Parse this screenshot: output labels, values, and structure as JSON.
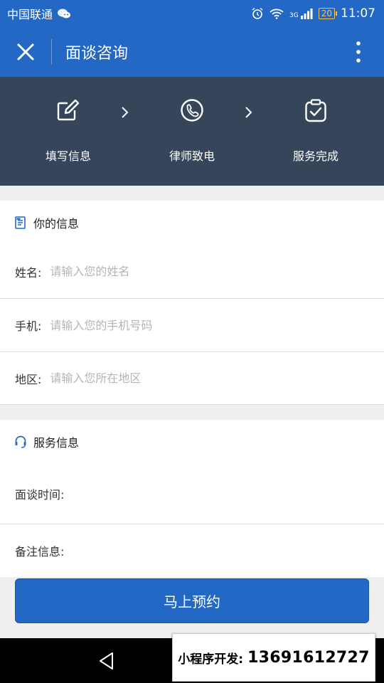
{
  "status_bar": {
    "carrier": "中国联通",
    "network": "3G",
    "battery": "20",
    "time": "11:07",
    "icons": [
      "wechat-icon",
      "alarm-icon",
      "wifi-icon",
      "signal-icon",
      "battery-icon"
    ]
  },
  "title_bar": {
    "title": "面谈咨询",
    "close_icon": "close-icon",
    "more_icon": "more-vertical-icon"
  },
  "steps": [
    {
      "label": "填写信息",
      "icon": "edit-icon"
    },
    {
      "label": "律师致电",
      "icon": "phone-icon"
    },
    {
      "label": "服务完成",
      "icon": "clipboard-check-icon"
    }
  ],
  "your_info": {
    "title": "你的信息",
    "icon": "document-icon",
    "fields": [
      {
        "label": "姓名:",
        "placeholder": "请输入您的姓名",
        "value": ""
      },
      {
        "label": "手机:",
        "placeholder": "请输入您的手机号码",
        "value": ""
      },
      {
        "label": "地区:",
        "placeholder": "请输入您所在地区",
        "value": ""
      }
    ]
  },
  "service_info": {
    "title": "服务信息",
    "icon": "headset-icon",
    "fields": [
      {
        "label": "面谈时间:",
        "value": ""
      },
      {
        "label": "备注信息:",
        "value": ""
      }
    ]
  },
  "submit_label": "马上预约",
  "watermark": {
    "prefix": "小程序开发:",
    "phone": "13691612727"
  },
  "colors": {
    "primary": "#2368c4",
    "steps_bg": "#37455a",
    "page_bg": "#efefef"
  }
}
